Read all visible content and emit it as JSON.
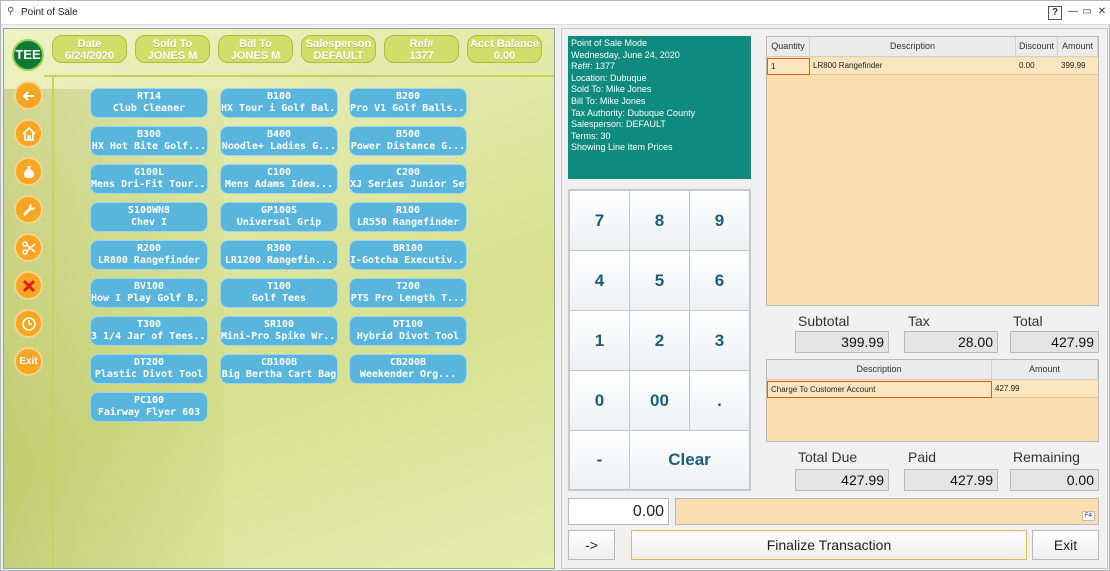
{
  "window": {
    "title": "Point of Sale",
    "help_label": "?",
    "minimize_label": "—",
    "maximize_label": "▭",
    "close_label": "✕"
  },
  "left": {
    "tee_label": "TEE",
    "info": [
      {
        "label": "Date",
        "value": "6/24/2020"
      },
      {
        "label": "Sold To",
        "value": "JONES M"
      },
      {
        "label": "Bill To",
        "value": "JONES M"
      },
      {
        "label": "Salesperson",
        "value": "DEFAULT"
      },
      {
        "label": "Ref#",
        "value": "1377"
      },
      {
        "label": "Acct Balance",
        "value": "0.00"
      }
    ],
    "side_buttons": [
      {
        "icon": "arrow-left-icon"
      },
      {
        "icon": "home-icon"
      },
      {
        "icon": "money-bag-icon"
      },
      {
        "icon": "wrench-icon"
      },
      {
        "icon": "scissors-icon"
      },
      {
        "icon": "cancel-x-icon"
      },
      {
        "icon": "clock-icon"
      },
      {
        "icon": "exit-icon",
        "label": "Exit"
      }
    ],
    "products": [
      {
        "code": "RT14",
        "name": "Club Cleaner"
      },
      {
        "code": "B100",
        "name": "HX Tour i Golf Bal..."
      },
      {
        "code": "B200",
        "name": "Pro V1 Golf Balls..."
      },
      {
        "code": "B300",
        "name": "HX Hot Bite Golf..."
      },
      {
        "code": "B400",
        "name": "Noodle+ Ladies G..."
      },
      {
        "code": "B500",
        "name": "Power Distance G..."
      },
      {
        "code": "G100L",
        "name": "Mens Dri-Fit Tour..."
      },
      {
        "code": "C100",
        "name": "Mens Adams Idea..."
      },
      {
        "code": "C200",
        "name": "XJ Series Junior Set"
      },
      {
        "code": "S100WN8",
        "name": "Chev I"
      },
      {
        "code": "GP100S",
        "name": "Universal Grip"
      },
      {
        "code": "R100",
        "name": "LR550 Rangefinder"
      },
      {
        "code": "R200",
        "name": "LR800 Rangefinder"
      },
      {
        "code": "R300",
        "name": "LR1200 Rangefin..."
      },
      {
        "code": "BR100",
        "name": "I-Gotcha Executiv..."
      },
      {
        "code": "BV100",
        "name": "How I Play Golf B..."
      },
      {
        "code": "T100",
        "name": "Golf Tees"
      },
      {
        "code": "T200",
        "name": "PTS Pro Length T..."
      },
      {
        "code": "T300",
        "name": "3 1/4 Jar of Tees..."
      },
      {
        "code": "SR100",
        "name": "Mini-Pro Spike Wr..."
      },
      {
        "code": "DT100",
        "name": "Hybrid Divot Tool"
      },
      {
        "code": "DT200",
        "name": "Plastic Divot Tool"
      },
      {
        "code": "CB100B",
        "name": "Big Bertha Cart Bag"
      },
      {
        "code": "CB200B",
        "name": "Weekender Org..."
      },
      {
        "code": "PC100",
        "name": "Fairway Flyer 603"
      }
    ]
  },
  "info_panel": {
    "lines": [
      "Point of Sale Mode",
      "Wednesday, June 24, 2020",
      "Ref#: 1377",
      "Location: Dubuque",
      "Sold To: Mike Jones",
      "Bill To: Mike Jones",
      "Tax Authority: Dubuque County",
      "Salesperson: DEFAULT",
      "Terms: 30",
      "Showing Line Item Prices"
    ]
  },
  "keypad": {
    "keys": [
      "7",
      "8",
      "9",
      "4",
      "5",
      "6",
      "1",
      "2",
      "3",
      "0",
      "00",
      ".",
      "-",
      "Clear"
    ]
  },
  "line_items": {
    "headers": {
      "quantity": "Quantity",
      "description": "Description",
      "discount": "Discount",
      "amount": "Amount"
    },
    "rows": [
      {
        "quantity": "1",
        "description": "LR800 Rangefinder",
        "discount": "0.00",
        "amount": "399.99"
      }
    ]
  },
  "totals": {
    "subtotal_label": "Subtotal",
    "subtotal": "399.99",
    "tax_label": "Tax",
    "tax": "28.00",
    "total_label": "Total",
    "total": "427.99"
  },
  "payments": {
    "headers": {
      "description": "Description",
      "amount": "Amount"
    },
    "rows": [
      {
        "description": "Charge To Customer Account",
        "amount": "427.99"
      }
    ]
  },
  "due": {
    "total_due_label": "Total Due",
    "total_due": "427.99",
    "paid_label": "Paid",
    "paid": "427.99",
    "remaining_label": "Remaining",
    "remaining": "0.00"
  },
  "entry": {
    "value": "0.00",
    "f4_label": "F4"
  },
  "buttons": {
    "arrow": "->",
    "finalize": "Finalize Transaction",
    "exit": "Exit"
  },
  "colors": {
    "teal": "#0f8a7e",
    "product_blue": "#5ab5dd",
    "side_orange": "#f5a623",
    "grid_peach": "#f9deb0",
    "info_lime": "#cfe06a"
  }
}
